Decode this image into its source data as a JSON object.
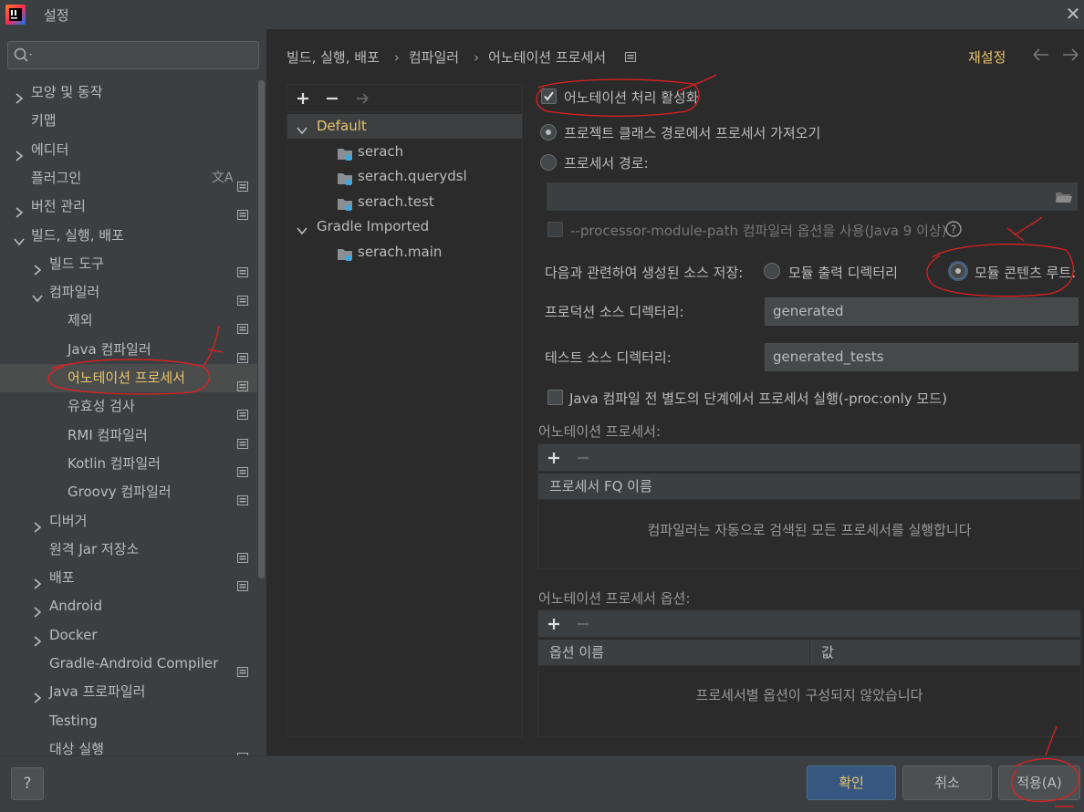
{
  "window": {
    "title": "설정"
  },
  "sidebar": {
    "search": {
      "placeholder": ""
    },
    "items": [
      {
        "label": "모양 및 동작"
      },
      {
        "label": "키맵"
      },
      {
        "label": "에디터"
      },
      {
        "label": "플러그인"
      },
      {
        "label": "버전 관리"
      },
      {
        "label": "빌드, 실행, 배포"
      },
      {
        "label": "빌드 도구"
      },
      {
        "label": "컴파일러"
      },
      {
        "label": "제외"
      },
      {
        "label": "Java 컴파일러"
      },
      {
        "label": "어노테이션 프로세서"
      },
      {
        "label": "유효성 검사"
      },
      {
        "label": "RMI 컴파일러"
      },
      {
        "label": "Kotlin 컴파일러"
      },
      {
        "label": "Groovy 컴파일러"
      },
      {
        "label": "디버거"
      },
      {
        "label": "원격 Jar 저장소"
      },
      {
        "label": "배포"
      },
      {
        "label": "Android"
      },
      {
        "label": "Docker"
      },
      {
        "label": "Gradle-Android Compiler"
      },
      {
        "label": "Java 프로파일러"
      },
      {
        "label": "Testing"
      },
      {
        "label": "대상 실행"
      }
    ]
  },
  "header": {
    "breadcrumb": [
      "빌드, 실행, 배포",
      "컴파일러",
      "어노테이션 프로세서"
    ],
    "reset_label": "재설정"
  },
  "modules": {
    "items": [
      {
        "label": "Default"
      },
      {
        "label": "serach"
      },
      {
        "label": "serach.querydsl"
      },
      {
        "label": "serach.test"
      },
      {
        "label": "Gradle Imported"
      },
      {
        "label": "serach.main"
      }
    ]
  },
  "settings": {
    "enable_label": "어노테이션 처리 활성화",
    "enable_checked": true,
    "from_classpath_label": "프로젝트 클래스 경로에서 프로세서 가져오기",
    "processor_path_label": "프로세서 경로:",
    "processor_path_value": "",
    "module_path_label": "--processor-module-path 컴파일러 옵션을 사용(Java 9 이상)",
    "store_label": "다음과 관련하여 생성된 소스 저장:",
    "store_option_output": "모듈 출력 디렉터리",
    "store_option_content": "모듈 콘텐츠 루트:",
    "prod_dir_label": "프로덕션 소스 디렉터리:",
    "prod_dir_value": "generated",
    "test_dir_label": "테스트 소스 디렉터리:",
    "test_dir_value": "generated_tests",
    "proc_only_label": "Java 컴파일 전 별도의 단계에서 프로세서 실행(-proc:only 모드)"
  },
  "processors_table": {
    "title": "어노테이션 프로세서:",
    "column": "프로세서 FQ 이름",
    "empty_text": "컴파일러는 자동으로 검색된 모든 프로세서를 실행합니다"
  },
  "options_table": {
    "title": "어노테이션 프로세서 옵션:",
    "columns": [
      "옵션 이름",
      "값"
    ],
    "empty_text": "프로세서별 옵션이 구성되지 않았습니다"
  },
  "footer": {
    "help_label": "?",
    "ok_label": "확인",
    "cancel_label": "취소",
    "apply_label": "적용(A)"
  },
  "colors": {
    "accent": "#e8c46a",
    "background": "#2b2b2b",
    "panel": "#3c3f41",
    "annotation": "#e02020"
  }
}
